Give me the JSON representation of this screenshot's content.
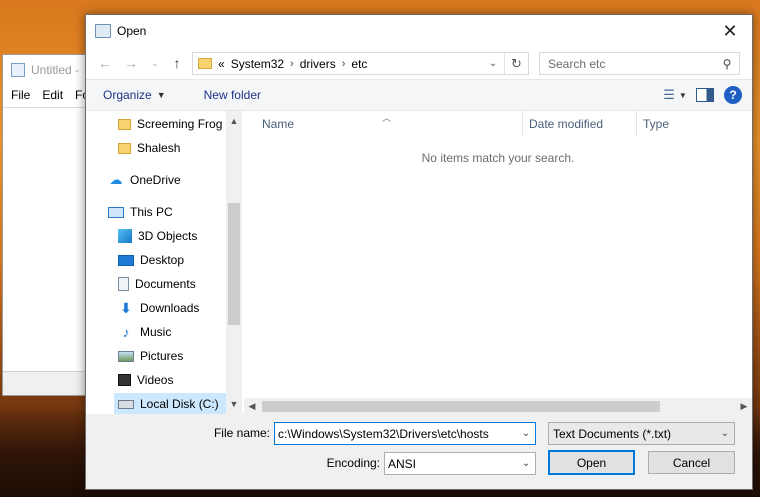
{
  "notepad": {
    "title": "Untitled -",
    "menu": [
      "File",
      "Edit",
      "Fo"
    ]
  },
  "dialog": {
    "title": "Open",
    "close_glyph": "✕",
    "address": {
      "overflow": "«",
      "crumbs": [
        "System32",
        "drivers",
        "etc"
      ]
    },
    "search": {
      "placeholder": "Search etc"
    },
    "toolbar": {
      "organize": "Organize",
      "new_folder": "New folder"
    },
    "nav_items": [
      {
        "label": "Screeming Frog",
        "icon": "folder-icon"
      },
      {
        "label": "Shalesh",
        "icon": "folder-icon"
      },
      {
        "label": "OneDrive",
        "icon": "cloud-icon"
      },
      {
        "label": "This PC",
        "icon": "computer-icon"
      },
      {
        "label": "3D Objects",
        "icon": "cube-icon"
      },
      {
        "label": "Desktop",
        "icon": "desktop-icon"
      },
      {
        "label": "Documents",
        "icon": "document-icon"
      },
      {
        "label": "Downloads",
        "icon": "download-icon"
      },
      {
        "label": "Music",
        "icon": "music-icon"
      },
      {
        "label": "Pictures",
        "icon": "pictures-icon"
      },
      {
        "label": "Videos",
        "icon": "video-icon"
      },
      {
        "label": "Local Disk (C:)",
        "icon": "disk-icon"
      }
    ],
    "columns": [
      "Name",
      "Date modified",
      "Type"
    ],
    "empty_message": "No items match your search.",
    "file_name_label": "File name:",
    "file_name_value": "c:\\Windows\\System32\\Drivers\\etc\\hosts",
    "file_type_value": "Text Documents (*.txt)",
    "encoding_label": "Encoding:",
    "encoding_value": "ANSI",
    "open_button": "Open",
    "cancel_button": "Cancel"
  }
}
